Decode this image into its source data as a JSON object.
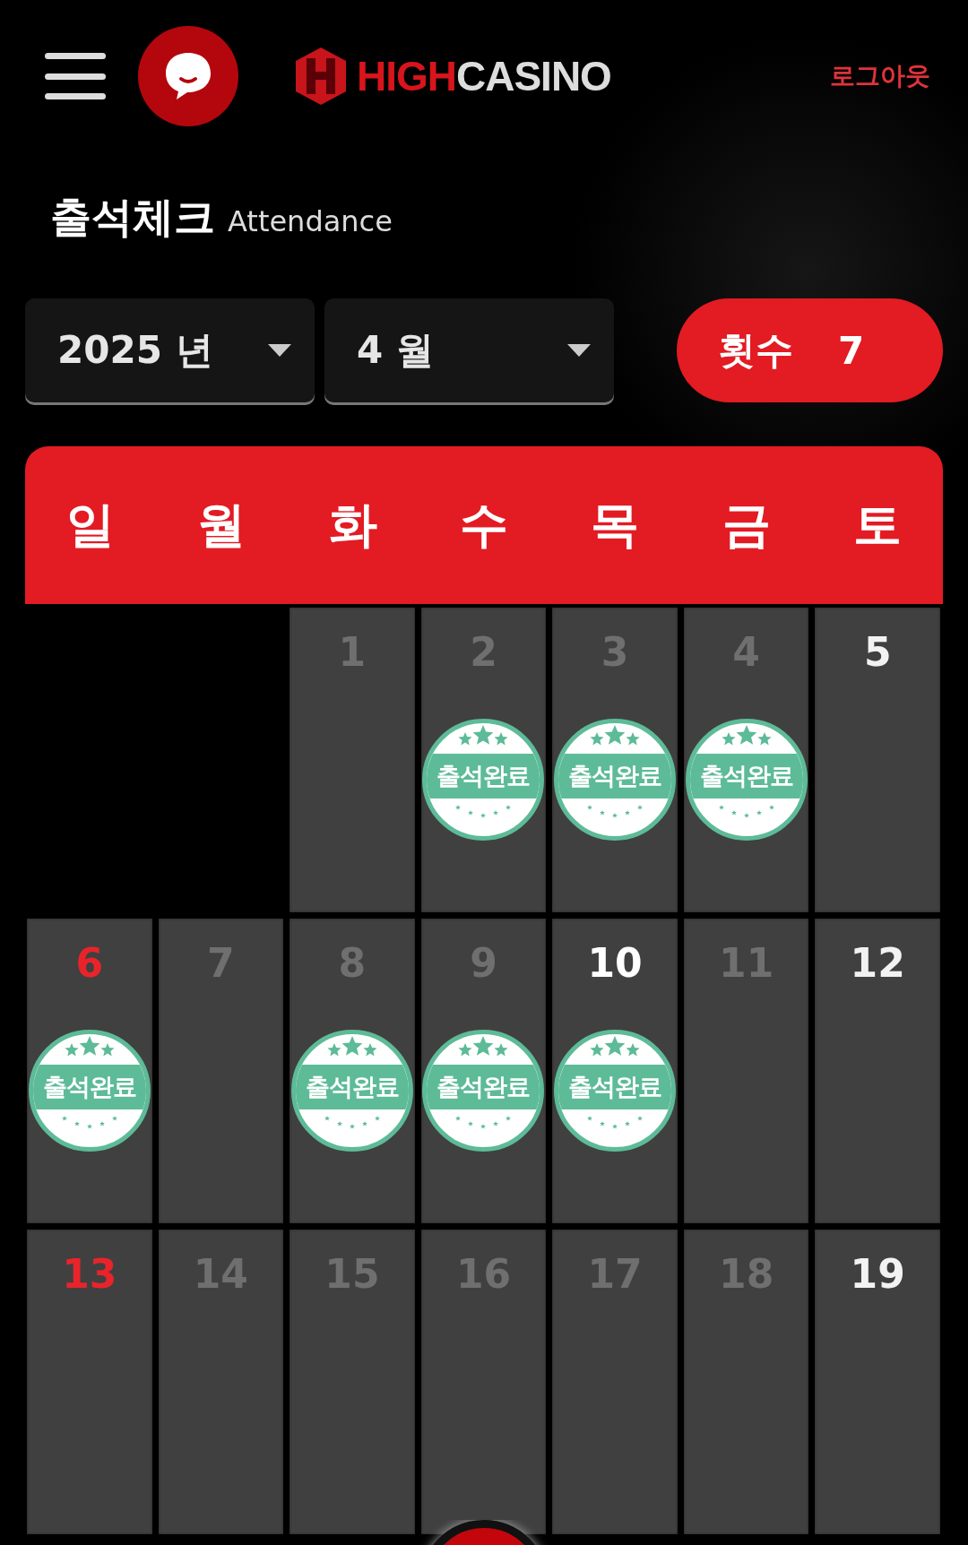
{
  "header": {
    "logo": {
      "accent": "HIGH",
      "text": "CASINO"
    },
    "logout": "로그아웃"
  },
  "title": {
    "main": "출석체크",
    "sub": "Attendance"
  },
  "filters": {
    "year": "2025 년",
    "month": "4 월"
  },
  "count": {
    "label": "횟수",
    "value": "7"
  },
  "weekdays": [
    {
      "label": "일"
    },
    {
      "label": "월"
    },
    {
      "label": "화"
    },
    {
      "label": "수"
    },
    {
      "label": "목"
    },
    {
      "label": "금"
    },
    {
      "label": "토"
    }
  ],
  "days": [
    {
      "kind": "blank"
    },
    {
      "kind": "blank"
    },
    {
      "day": "1",
      "kind": "weekday"
    },
    {
      "day": "2",
      "kind": "weekday",
      "stamp": "출석완료"
    },
    {
      "day": "3",
      "kind": "weekday",
      "stamp": "출석완료"
    },
    {
      "day": "4",
      "kind": "weekday",
      "stamp": "출석완료"
    },
    {
      "day": "5",
      "kind": "saturday"
    },
    {
      "day": "6",
      "kind": "sunday",
      "stamp": "출석완료"
    },
    {
      "day": "7",
      "kind": "weekday"
    },
    {
      "day": "8",
      "kind": "weekday",
      "stamp": "출석완료"
    },
    {
      "day": "9",
      "kind": "weekday",
      "stamp": "출석완료"
    },
    {
      "day": "10",
      "kind": "today",
      "stamp": "출석완료"
    },
    {
      "day": "11",
      "kind": "weekday"
    },
    {
      "day": "12",
      "kind": "saturday"
    },
    {
      "day": "13",
      "kind": "sunday"
    },
    {
      "day": "14",
      "kind": "weekday"
    },
    {
      "day": "15",
      "kind": "weekday"
    },
    {
      "day": "16",
      "kind": "weekday"
    },
    {
      "day": "17",
      "kind": "weekday"
    },
    {
      "day": "18",
      "kind": "weekday"
    },
    {
      "day": "19",
      "kind": "saturday"
    }
  ]
}
